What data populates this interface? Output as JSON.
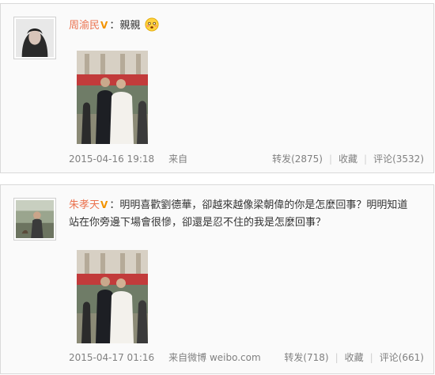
{
  "posts": [
    {
      "username": "周渝民",
      "verified_badge": "V",
      "separator": "：",
      "text": "親親",
      "emoji": "blushing-emoji",
      "timestamp": "2015-04-16 19:18",
      "source": "来自",
      "repost": "转发(2875)",
      "favorite": "收藏",
      "comment": "评论(3532)"
    },
    {
      "username": "朱孝天",
      "verified_badge": "V",
      "separator": "：",
      "text_line1": "明明喜歡劉德華，卻越來越像梁朝偉的你是怎麼回事？明明知道",
      "text_line2": "站在你旁邊下場會很慘，卻還是忍不住的我是怎麼回事？",
      "timestamp": "2015-04-17 01:16",
      "source": "来自微博 weibo.com",
      "repost": "转发(718)",
      "favorite": "收藏",
      "comment": "评论(661)"
    }
  ],
  "colors": {
    "username": "#eb7350",
    "badge": "#f29300",
    "meta": "#808080",
    "card_bg": "#fafafa",
    "border": "#d9d9d9"
  }
}
